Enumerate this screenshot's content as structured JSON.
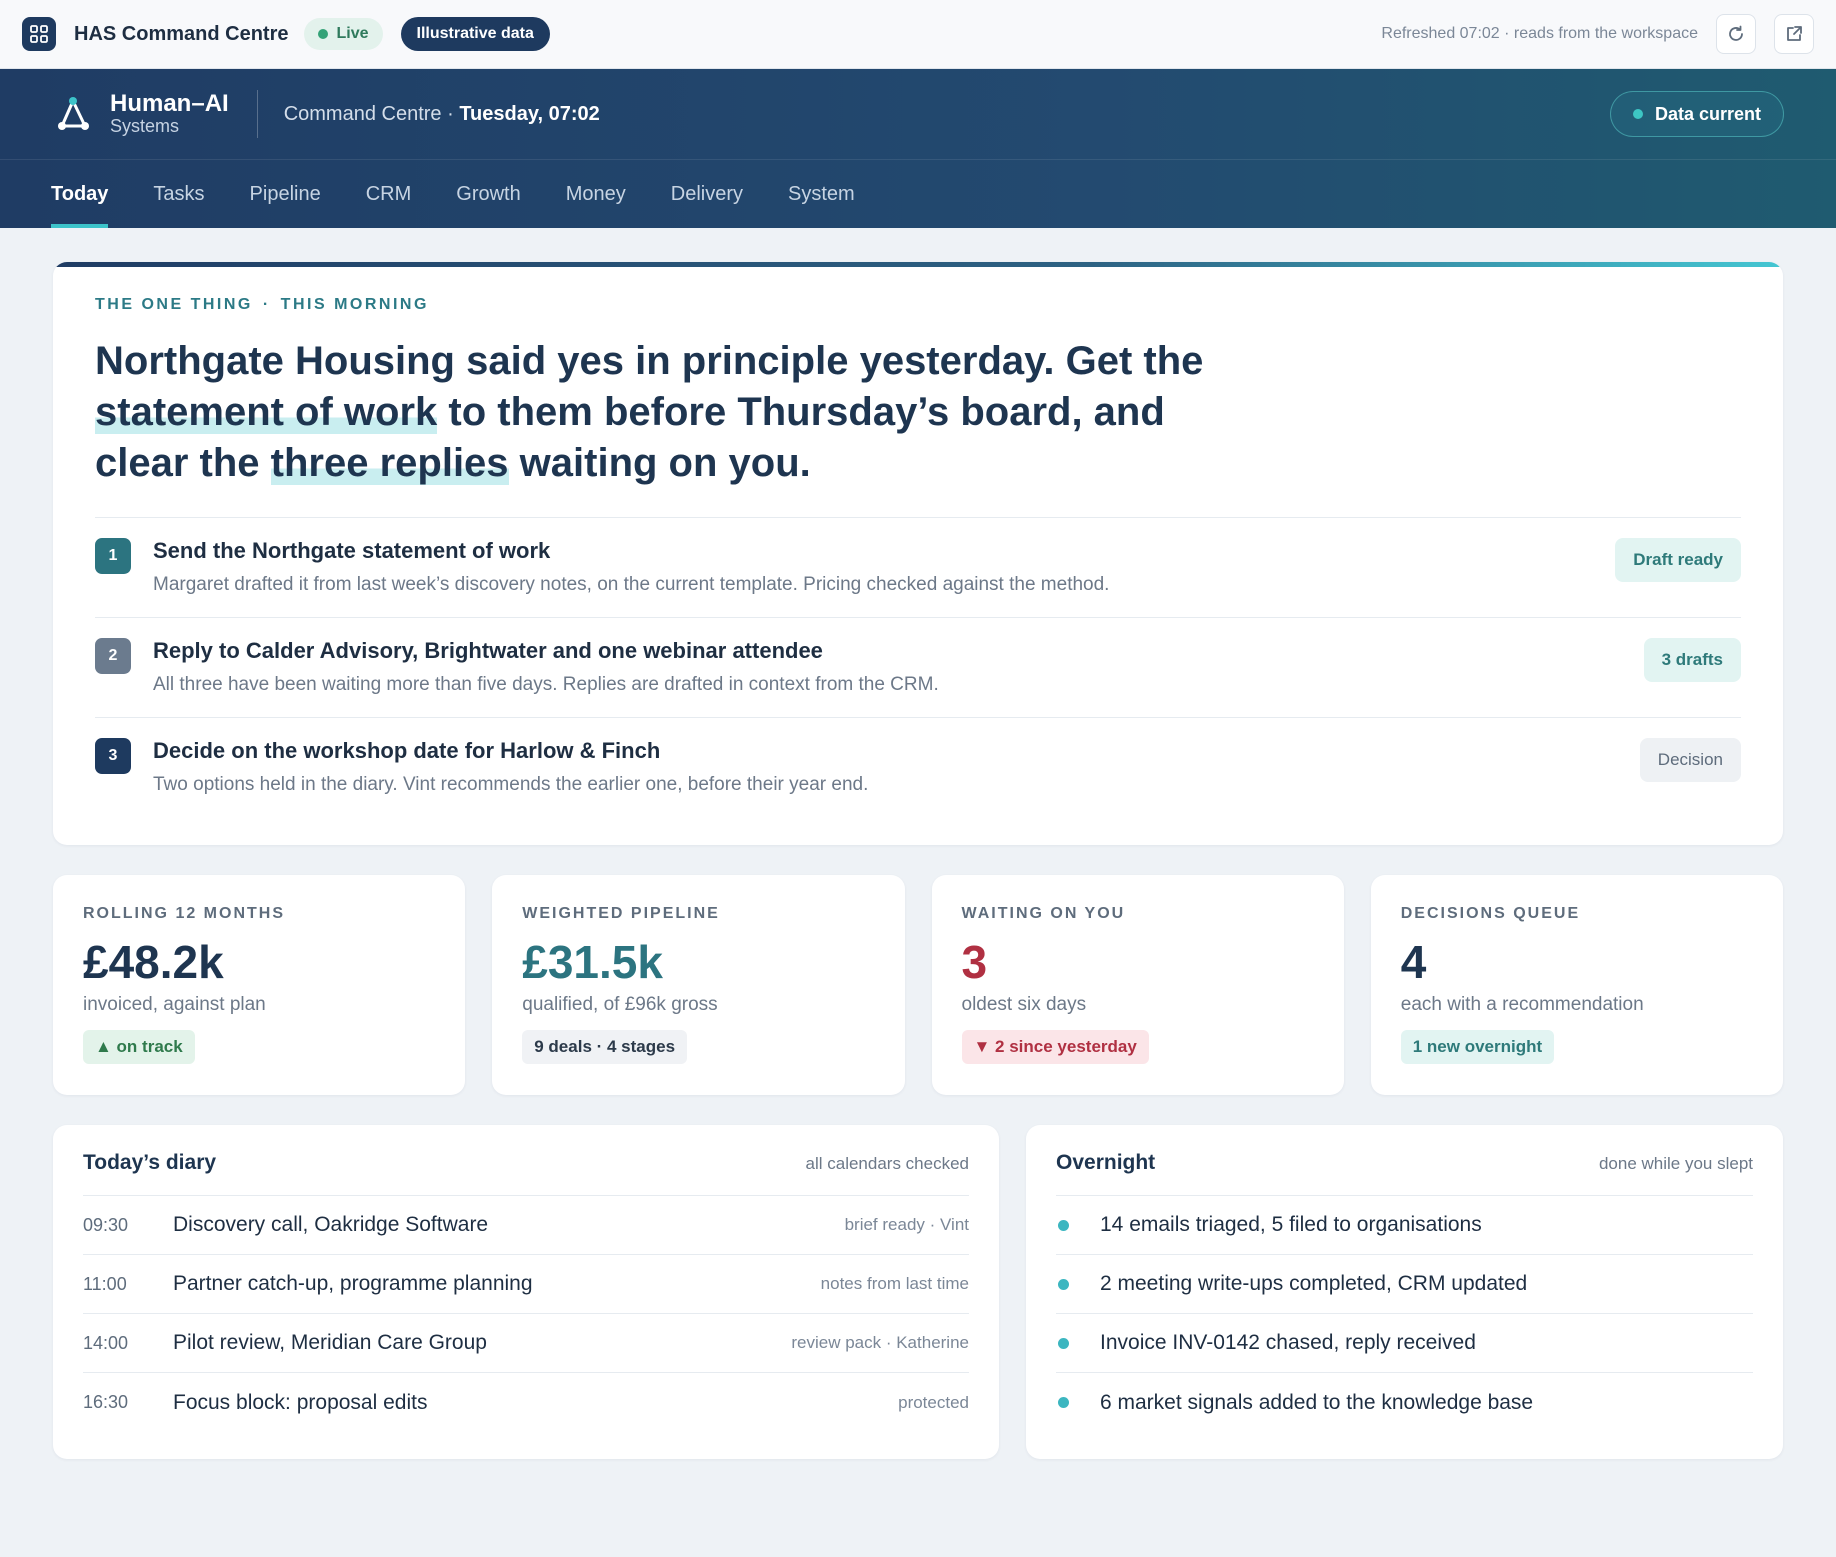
{
  "topbar": {
    "title": "HAS Command Centre",
    "live_label": "Live",
    "data_badge": "Illustrative data",
    "refresh_text": "Refreshed 07:02 · reads from the workspace",
    "icons": [
      "grid-icon",
      "refresh-icon",
      "external-link-icon"
    ]
  },
  "header": {
    "brand_name": "Human–AI",
    "brand_sub": "Systems",
    "context_prefix": "Command Centre · ",
    "context_day": "Tuesday, 07:02",
    "status_label": "Data current"
  },
  "nav": {
    "items": [
      "Today",
      "Tasks",
      "Pipeline",
      "CRM",
      "Growth",
      "Money",
      "Delivery",
      "System"
    ],
    "active": "Today"
  },
  "hero": {
    "eyebrow_left": "The one thing",
    "eyebrow_sep": "·",
    "eyebrow_right": "This morning",
    "headline_1": "Northgate Housing said yes in principle yesterday. Get the ",
    "headline_hl_1": "statement of work",
    "headline_2": " to them before Thursday’s board, and clear the ",
    "headline_hl_2": "three replies",
    "headline_3": " waiting on you.",
    "actions": [
      {
        "num": "1",
        "title": "Send the Northgate statement of work",
        "desc": "Margaret drafted it from last week’s discovery notes, on the current template. Pricing checked against the method.",
        "tag": "Draft ready"
      },
      {
        "num": "2",
        "title": "Reply to Calder Advisory, Brightwater and one webinar attendee",
        "desc": "All three have been waiting more than five days. Replies are drafted in context from the CRM.",
        "tag": "3 drafts"
      },
      {
        "num": "3",
        "title": "Decide on the workshop date for Harlow & Finch",
        "desc": "Two options held in the diary. Vint recommends the earlier one, before their year end.",
        "tag": "Decision"
      }
    ]
  },
  "kpis": [
    {
      "label": "Rolling 12 months",
      "value": "£48.2k",
      "sub": "invoiced, against plan",
      "badge": "▲ on track"
    },
    {
      "label": "Weighted pipeline",
      "value": "£31.5k",
      "sub": "qualified, of £96k gross",
      "badge": "9 deals · 4 stages"
    },
    {
      "label": "Waiting on you",
      "value": "3",
      "sub": "oldest six days",
      "badge": "▼ 2 since yesterday"
    },
    {
      "label": "Decisions queue",
      "value": "4",
      "sub": "each with a recommendation",
      "badge": "1 new overnight"
    }
  ],
  "diary": {
    "title": "Today’s diary",
    "note": "all calendars checked",
    "rows": [
      {
        "time": "09:30",
        "event": "Discovery call, Oakridge Software",
        "meta": "brief ready · Vint"
      },
      {
        "time": "11:00",
        "event": "Partner catch-up, programme planning",
        "meta": "notes from last time"
      },
      {
        "time": "14:00",
        "event": "Pilot review, Meridian Care Group",
        "meta": "review pack · Katherine"
      },
      {
        "time": "16:30",
        "event": "Focus block: proposal edits",
        "meta": "protected"
      }
    ]
  },
  "overnight": {
    "title": "Overnight",
    "note": "done while you slept",
    "items": [
      "14 emails triaged, 5 filed to organisations",
      "2 meeting write-ups completed, CRM updated",
      "Invoice INV-0142 chased, reply received",
      "6 market signals added to the knowledge base"
    ]
  },
  "colors": {
    "navy": "#1e3a5f",
    "teal_accent": "#3cc3c9",
    "alert_red": "#b03042",
    "success_green": "#34a277"
  }
}
